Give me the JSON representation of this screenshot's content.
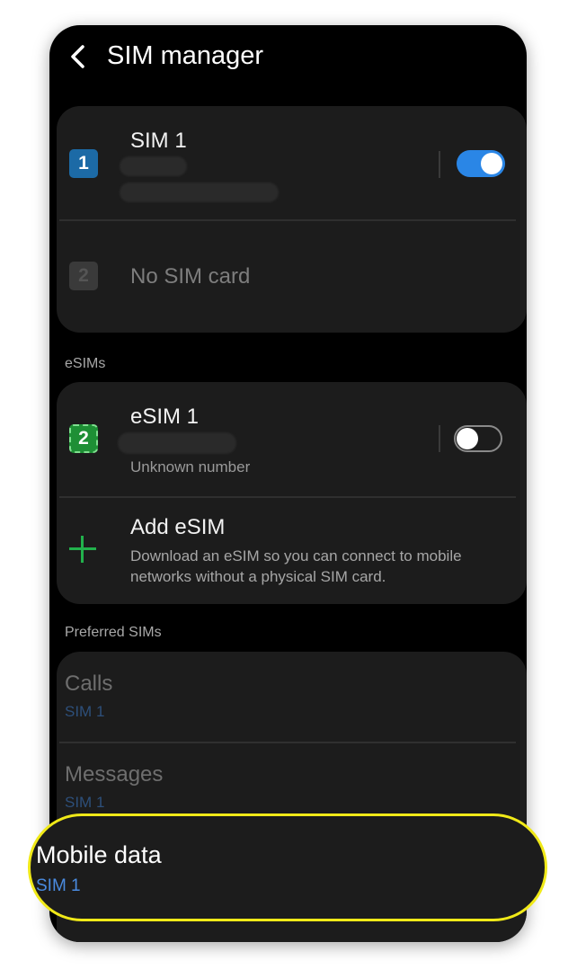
{
  "header": {
    "title": "SIM manager"
  },
  "sims": [
    {
      "badge": "1",
      "name": "SIM 1",
      "toggle_on": true
    },
    {
      "badge": "2",
      "name": "No SIM card"
    }
  ],
  "esims_section": {
    "label": "eSIMs"
  },
  "esim": {
    "badge": "2",
    "name": "eSIM 1",
    "subtitle": "Unknown number",
    "toggle_on": false
  },
  "add_esim": {
    "title": "Add eSIM",
    "description": "Download an eSIM so you can connect to mobile networks without a physical SIM card."
  },
  "preferred_section": {
    "label": "Preferred SIMs"
  },
  "preferred": {
    "calls": {
      "title": "Calls",
      "value": "SIM 1"
    },
    "messages": {
      "title": "Messages",
      "value": "SIM 1"
    },
    "mobile_data": {
      "title": "Mobile data",
      "value": "SIM 1"
    }
  },
  "colors": {
    "accent": "#2a86e6",
    "highlight": "#f0e918",
    "esim_green": "#1e8f35",
    "plus_green": "#22b14c"
  }
}
